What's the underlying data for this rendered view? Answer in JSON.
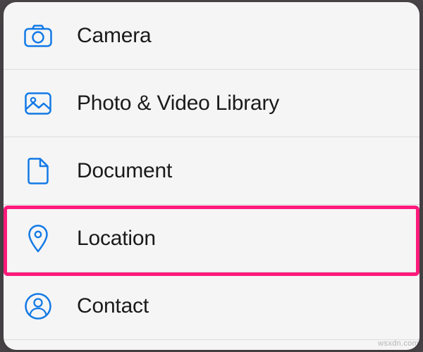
{
  "menu": {
    "items": [
      {
        "id": "camera",
        "label": "Camera"
      },
      {
        "id": "photo-video-library",
        "label": "Photo & Video Library"
      },
      {
        "id": "document",
        "label": "Document"
      },
      {
        "id": "location",
        "label": "Location"
      },
      {
        "id": "contact",
        "label": "Contact"
      }
    ]
  },
  "colors": {
    "icon_blue": "#1279e6",
    "highlight_pink": "#ff1a7a",
    "sheet_bg": "#f5f5f5",
    "text": "#1a1a1a",
    "divider": "#dcdcdc"
  },
  "highlighted_index": 3,
  "watermark": "wsxdn.com"
}
